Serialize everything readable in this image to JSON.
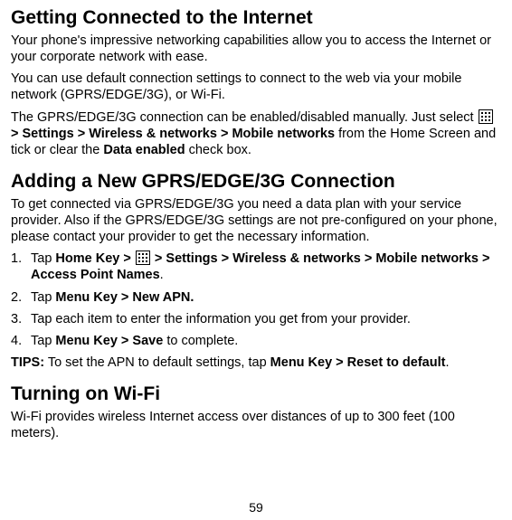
{
  "page_number": "59",
  "section1": {
    "heading": "Getting Connected to the Internet",
    "p1": "Your phone's impressive networking capabilities allow you to access the Internet or your corporate network with ease.",
    "p2": "You can use default connection settings to connect to the web via your mobile network (GPRS/EDGE/3G), or Wi-Fi.",
    "p3_a": "The GPRS/EDGE/3G connection can be enabled/disabled manually. Just select ",
    "p3_b": " > Settings > Wireless & networks > Mobile networks",
    "p3_c": " from the Home Screen and tick or clear the ",
    "p3_d": "Data enabled",
    "p3_e": " check box."
  },
  "section2": {
    "heading": "Adding a New GPRS/EDGE/3G Connection",
    "p1": "To get connected via GPRS/EDGE/3G you need a data plan with your service provider. Also if the GPRS/EDGE/3G settings are not pre-configured on your phone, please contact your provider to get the necessary information.",
    "li1_num": "1.",
    "li1_a": "Tap ",
    "li1_b": "Home Key > ",
    "li1_c": " > Settings > Wireless & networks > Mobile networks > Access Point Names",
    "li1_d": ".",
    "li2_num": "2.",
    "li2_a": "Tap ",
    "li2_b": "Menu Key > New APN.",
    "li3_num": "3.",
    "li3": "Tap each item to enter the information you get from your provider.",
    "li4_num": "4.",
    "li4_a": "Tap ",
    "li4_b": "Menu Key > Save",
    "li4_c": " to complete.",
    "tips_a": "TIPS:",
    "tips_b": " To set the APN to default settings, tap ",
    "tips_c": "Menu Key > Reset to default",
    "tips_d": "."
  },
  "section3": {
    "heading": "Turning on Wi-Fi",
    "p1": "Wi-Fi provides wireless Internet access over distances of up to 300 feet (100 meters)."
  }
}
